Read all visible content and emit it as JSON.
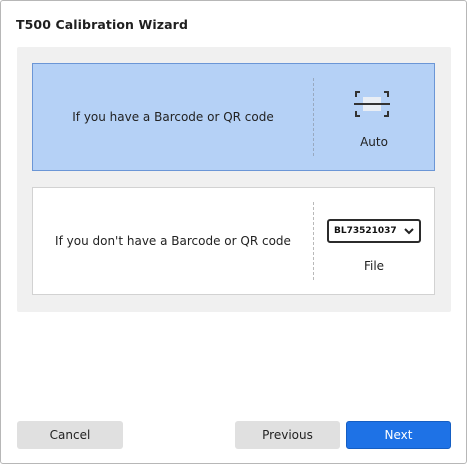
{
  "window": {
    "title": "T500 Calibration Wizard"
  },
  "options": {
    "barcode": {
      "text": "If you have a Barcode or QR code",
      "action_label": "Auto",
      "icon": "barcode-scan-icon",
      "selected": true
    },
    "no_barcode": {
      "text": "If you don't have a Barcode or QR code",
      "select_value": "BL73521037",
      "action_label": "File",
      "icon": "chevron-down-icon",
      "selected": false
    }
  },
  "footer": {
    "cancel_label": "Cancel",
    "previous_label": "Previous",
    "next_label": "Next"
  },
  "colors": {
    "selected_card_bg": "#b5d1f6",
    "selected_card_border": "#6b96d6",
    "primary_button": "#1e72e6",
    "panel_bg": "#f0f0f0"
  }
}
